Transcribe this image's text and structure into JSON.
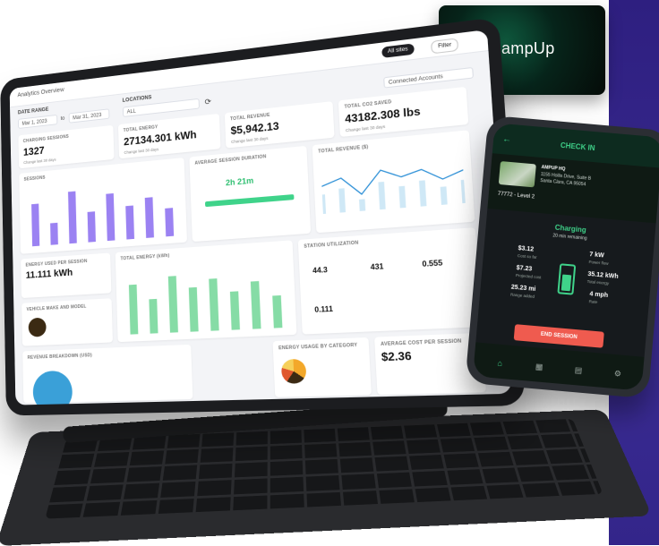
{
  "brand": {
    "logo_word": "ampUp",
    "logo_mark": "m"
  },
  "tablet": {
    "breadcrumb": "Analytics Overview",
    "top_buttons": [
      "All sites",
      "Filter"
    ],
    "filters": {
      "date_label": "DATE RANGE",
      "date_from": "Mar 1, 2023",
      "to_label": "to",
      "date_to": "Mar 31, 2023",
      "location_label": "LOCATIONS",
      "location_value": "ALL",
      "right_select": "Connected Accounts"
    },
    "stats": [
      {
        "title": "CHARGING SESSIONS",
        "value": "1327",
        "sub": "Change last 30 days"
      },
      {
        "title": "TOTAL ENERGY",
        "value": "27134.301 kWh",
        "sub": "Change last 30 days"
      },
      {
        "title": "TOTAL REVENUE",
        "value": "$5,942.13",
        "sub": "Change last 30 days"
      },
      {
        "title": "TOTAL CO2 SAVED",
        "value": "43182.308 lbs",
        "sub": "Change last 30 days"
      }
    ],
    "panels": {
      "sessions": "SESSIONS",
      "avg_duration": "AVERAGE SESSION DURATION",
      "avg_duration_value": "2h 21m",
      "revenue": "TOTAL REVENUE ($)",
      "energy_per_session": "ENERGY USED PER SESSION",
      "energy_per_session_value": "11.111 kWh",
      "total_energy": "TOTAL ENERGY (kWh)",
      "utilization": "STATION UTILIZATION",
      "util_values": [
        "44.3",
        "431",
        "0.555"
      ],
      "util_small": "0.111",
      "vehicle": "VEHICLE MAKE AND MODEL",
      "revenue_by_site": "REVENUE BREAKDOWN (USD)",
      "energy_by_category": "ENERGY USAGE BY CATEGORY",
      "avg_cost": "AVERAGE COST PER SESSION",
      "avg_cost_value": "$2.36"
    },
    "sessions_bars": [
      0.78,
      0.4,
      0.95,
      0.55,
      0.85,
      0.6,
      0.72,
      0.5
    ],
    "energy_bars": [
      0.8,
      0.55,
      0.9,
      0.7,
      0.82,
      0.6,
      0.74,
      0.5
    ],
    "revenue_line": [
      0.5,
      0.62,
      0.3,
      0.7,
      0.55,
      0.65,
      0.45,
      0.58
    ]
  },
  "phone": {
    "title": "CHECK IN",
    "site_name": "AMPUP HQ",
    "site_addr": "1155 Hollis Drive, Suite B",
    "site_city": "Santa Clara, CA 95054",
    "charger": "77772 - Level 2",
    "status": "Charging",
    "status_sub": "20 min remaining",
    "stats": [
      {
        "value": "$3.12",
        "label": "Cost so far"
      },
      {
        "value": "7 kW",
        "label": "Power flow"
      },
      {
        "value": "$7.23",
        "label": "Projected cost"
      },
      {
        "value": "35.12 kWh",
        "label": "Total energy"
      },
      {
        "value": "25.23 mi",
        "label": "Range added"
      },
      {
        "value": "4 mph",
        "label": "Rate"
      }
    ],
    "end_button": "END SESSION",
    "tabs": [
      "Home",
      "Map",
      "History",
      "Settings"
    ]
  },
  "colors": {
    "accent_green": "#3fd38a",
    "purple": "#8b6cf0",
    "stripe": "#3a2b92",
    "end_red": "#ef5b4f"
  }
}
